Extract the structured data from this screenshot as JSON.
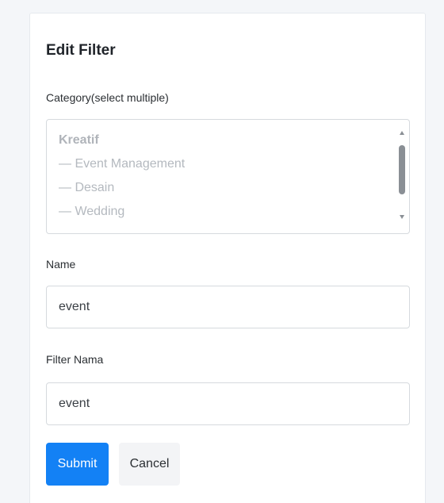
{
  "form": {
    "title": "Edit Filter",
    "category_label": "Category(select multiple)",
    "category_options": [
      {
        "label": "Kreatif",
        "group": true
      },
      {
        "label": "— Event Management",
        "group": false
      },
      {
        "label": "— Desain",
        "group": false
      },
      {
        "label": "— Wedding",
        "group": false
      }
    ],
    "name_label": "Name",
    "name_value": "event",
    "filter_name_label": "Filter Nama",
    "filter_name_value": "event",
    "submit_label": "Submit",
    "cancel_label": "Cancel"
  },
  "colors": {
    "primary": "#1381f5",
    "secondary_button_bg": "#f3f4f6",
    "border": "#d6dade",
    "option_text": "#b4b9bf"
  }
}
